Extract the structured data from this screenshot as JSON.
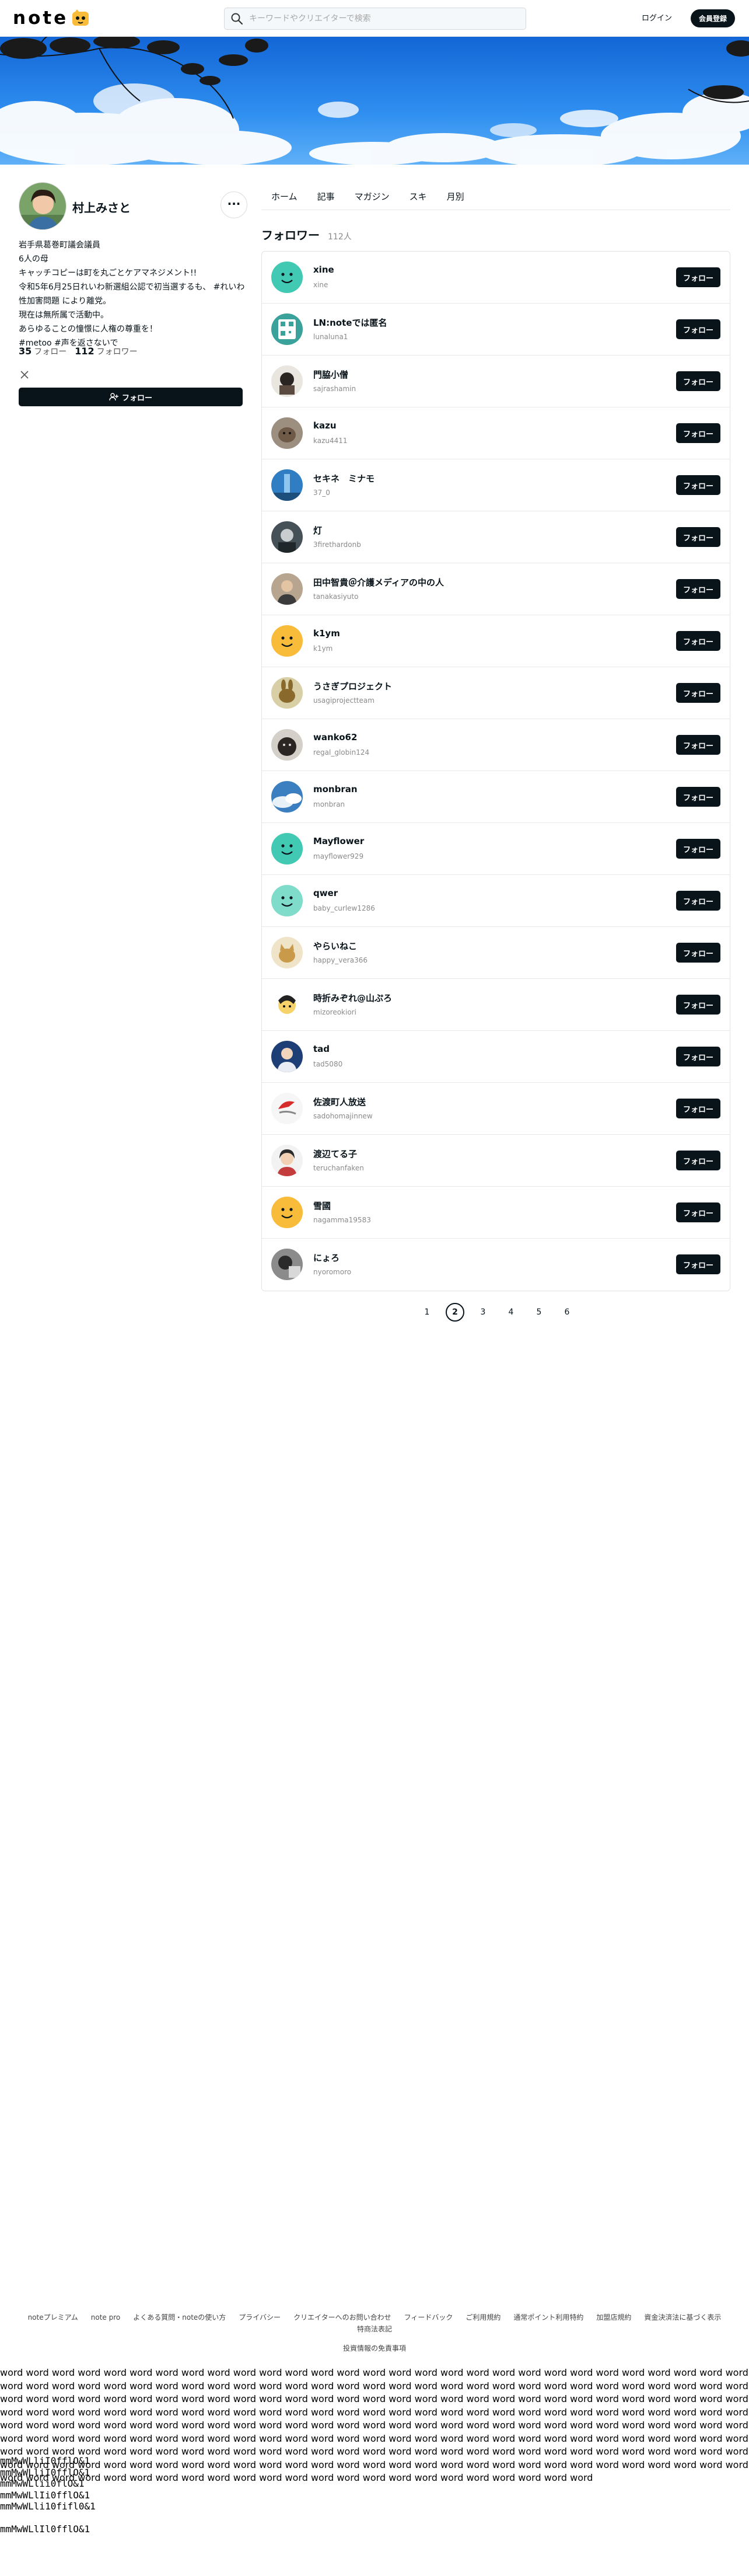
{
  "header": {
    "logo_text": "note",
    "search_placeholder": "キーワードやクリエイターで検索",
    "login_label": "ログイン",
    "signup_label": "会員登録"
  },
  "profile": {
    "name": "村上みさと",
    "bio": "岩手県葛巻町議会議員\n6人の母\nキャッチコピーは町を丸ごとケアマネジメント!!\n令和5年6月25日れいわ新選組公認で初当選するも、 #れいわ性加害問題 により離党。\n現在は無所属で活動中。\nあらゆることの憧憬に人権の尊重を！\n#metoo #声を返さないで",
    "follow_count": "35",
    "follow_label": "フォロー",
    "follower_count": "112",
    "follower_label": "フォロワー",
    "follow_button_label": "フォロー"
  },
  "tabs": [
    "ホーム",
    "記事",
    "マガジン",
    "スキ",
    "月別"
  ],
  "section": {
    "title": "フォロワー",
    "count": "112人"
  },
  "followers": [
    {
      "name": "xine",
      "id": "xine",
      "avatar": "smile-teal"
    },
    {
      "name": "LN:noteでは匿名",
      "id": "lunaluna1",
      "avatar": "qr"
    },
    {
      "name": "門脇小僧",
      "id": "sajrashamin",
      "avatar": "photo-dark"
    },
    {
      "name": "kazu",
      "id": "kazu4411",
      "avatar": "dog"
    },
    {
      "name": "セキネ　ミナモ",
      "id": "37_0",
      "avatar": "blue-sky"
    },
    {
      "name": "灯",
      "id": "3firethardonb",
      "avatar": "photo-gray"
    },
    {
      "name": "田中智貴＠介護メディアの中の人",
      "id": "tanakasiyuto",
      "avatar": "person"
    },
    {
      "name": "k1ym",
      "id": "k1ym",
      "avatar": "smile-yellow"
    },
    {
      "name": "うさぎプロジェクト",
      "id": "usagiprojectteam",
      "avatar": "rabbit"
    },
    {
      "name": "wanko62",
      "id": "regal_globin124",
      "avatar": "dark-dog"
    },
    {
      "name": "monbran",
      "id": "monbran",
      "avatar": "clouds"
    },
    {
      "name": "Mayflower",
      "id": "mayflower929",
      "avatar": "smile-teal"
    },
    {
      "name": "qwer",
      "id": "baby_curlew1286",
      "avatar": "smile-mint"
    },
    {
      "name": "やらいねこ",
      "id": "happy_vera366",
      "avatar": "cat"
    },
    {
      "name": "時折みぞれ@山ぷろ",
      "id": "mizoreokiori",
      "avatar": "anime"
    },
    {
      "name": "tad",
      "id": "tad5080",
      "avatar": "blue-person"
    },
    {
      "name": "佐渡町人放送",
      "id": "sadohomajinnew",
      "avatar": "red-logo"
    },
    {
      "name": "渡辺てる子",
      "id": "teruchanfaken",
      "avatar": "woman"
    },
    {
      "name": "雪國",
      "id": "nagamma19583",
      "avatar": "smile-yellow"
    },
    {
      "name": "にょろ",
      "id": "nyoromoro",
      "avatar": "bw-photo"
    }
  ],
  "follow_label": "フォロー",
  "pagination": [
    "1",
    "2",
    "3",
    "4",
    "5",
    "6"
  ],
  "pagination_current": "2",
  "footer": {
    "links": [
      "noteプレミアム",
      "note pro",
      "よくある質問・noteの使い方",
      "プライバシー",
      "クリエイターへのお問い合わせ",
      "フィードバック",
      "ご利用規約",
      "通常ポイント利用特約",
      "加盟店規約",
      "資金決済法に基づく表示",
      "特商法表記"
    ],
    "links2": "投資情報の免責事項"
  },
  "filler_text": "word word word word word word word word word word word word word word word word word word word word word word word word word word word word word word word word word word word word word word word word word word word word word word word word word word word word word word word word word word word word word word word word word word word word word word word word word word word word word word word word word word word word word word word word word word word word word word word word word word word word word word word word word word word word word word word word word word word word word word word word word word word word word word word word word word word word word word word word word word word word word word word word word word word word word word word word word word word word word word word word word word word word word word word word word word word word word word word word word word word word word word word word word word word word word word word word word word word word word word word word word word word word word word word word word word word word word word word word word word word word word word word word word word word word word word word word word word word word word word word word word word word word word word word word word word word word word word word",
  "mono_lines": [
    "mmMwWLliI0fflO&1",
    "mmMwWLliI0fflO&1",
    "mmMwWLlii0flO&1",
    "mmMwWLlIi0fflO&1",
    "mmMwWLli10fifl0&1",
    "",
    "mmMwWLlIl0fflO&1"
  ],
  "colors": {
    "accent": "#08131a",
    "teal": "#41c9b4",
    "yellow": "#f9bc3a"
  }
}
